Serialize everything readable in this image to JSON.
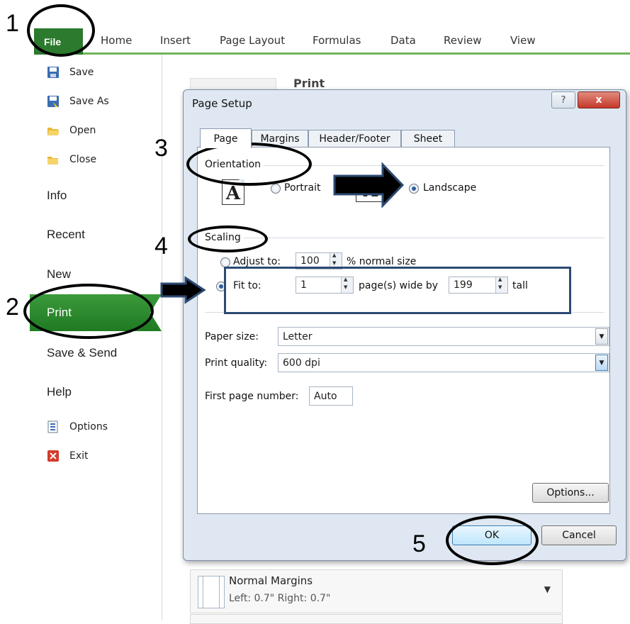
{
  "ribbon": {
    "file_tab": "File",
    "tabs": [
      "Home",
      "Insert",
      "Page Layout",
      "Formulas",
      "Data",
      "Review",
      "View"
    ]
  },
  "backstage": {
    "items_small": [
      {
        "label": "Save",
        "icon": "save-icon"
      },
      {
        "label": "Save As",
        "icon": "save-as-icon"
      },
      {
        "label": "Open",
        "icon": "folder-open-icon"
      },
      {
        "label": "Close",
        "icon": "folder-close-icon"
      }
    ],
    "info": "Info",
    "recent": "Recent",
    "new": "New",
    "print": "Print",
    "save_send": "Save & Send",
    "help": "Help",
    "options": "Options",
    "exit": "Exit"
  },
  "print_pane": {
    "title": "Print",
    "margins_title": "Normal Margins",
    "margins_sub": "Left: 0.7\"   Right: 0.7\""
  },
  "dialog": {
    "title": "Page Setup",
    "help_label": "?",
    "close_label": "x",
    "tabs": [
      "Page",
      "Margins",
      "Header/Footer",
      "Sheet"
    ],
    "orientation_label": "Orientation",
    "portrait_label": "Portrait",
    "landscape_label": "Landscape",
    "orientation_glyph": "A",
    "scaling_label": "Scaling",
    "adjust_to_label": "Adjust to:",
    "adjust_to_value": "100",
    "normal_size_label": "% normal size",
    "fit_to_label": "Fit to:",
    "fit_wide_value": "1",
    "pages_wide_label": "page(s) wide by",
    "fit_tall_value": "199",
    "tall_label": "tall",
    "paper_size_label": "Paper size:",
    "paper_size_value": "Letter",
    "print_quality_label": "Print quality:",
    "print_quality_value": "600 dpi",
    "first_page_label": "First page number:",
    "first_page_value": "Auto",
    "options_button": "Options...",
    "ok_button": "OK",
    "cancel_button": "Cancel"
  },
  "annotations": {
    "step1": "1",
    "step2": "2",
    "step3": "3",
    "step4": "4",
    "step5": "5"
  },
  "colors": {
    "file_tab": "#2b7a2d",
    "print_selected": "#2e8b30",
    "highlight_rect": "#2c4a72",
    "arrow_fill": "#000000"
  }
}
